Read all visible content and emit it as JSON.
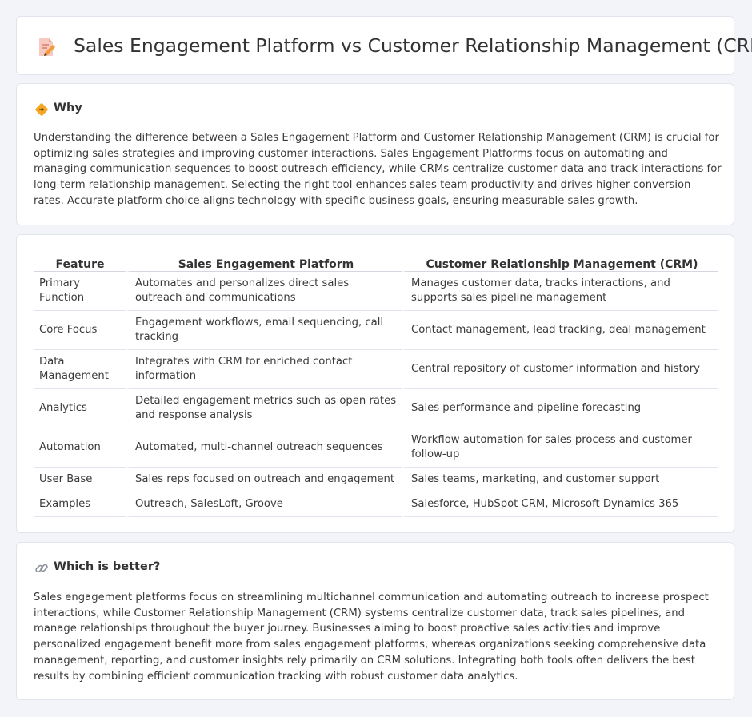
{
  "header": {
    "title": "Sales Engagement Platform vs Customer Relationship Management (CRM)",
    "icon": "pencil-document-icon"
  },
  "why": {
    "heading": "Why",
    "icon": "diamond-signpost-icon",
    "text": "Understanding the difference between a Sales Engagement Platform and Customer Relationship Management (CRM) is crucial for optimizing sales strategies and improving customer interactions. Sales Engagement Platforms focus on automating and managing communication sequences to boost outreach efficiency, while CRMs centralize customer data and track interactions for long-term relationship management. Selecting the right tool enhances sales team productivity and drives higher conversion rates. Accurate platform choice aligns technology with specific business goals, ensuring measurable sales growth."
  },
  "table": {
    "headers": [
      "Feature",
      "Sales Engagement Platform",
      "Customer Relationship Management (CRM)"
    ],
    "rows": [
      [
        "Primary Function",
        "Automates and personalizes direct sales outreach and communications",
        "Manages customer data, tracks interactions, and supports sales pipeline management"
      ],
      [
        "Core Focus",
        "Engagement workflows, email sequencing, call tracking",
        "Contact management, lead tracking, deal management"
      ],
      [
        "Data Management",
        "Integrates with CRM for enriched contact information",
        "Central repository of customer information and history"
      ],
      [
        "Analytics",
        "Detailed engagement metrics such as open rates and response analysis",
        "Sales performance and pipeline forecasting"
      ],
      [
        "Automation",
        "Automated, multi-channel outreach sequences",
        "Workflow automation for sales process and customer follow-up"
      ],
      [
        "User Base",
        "Sales reps focused on outreach and engagement",
        "Sales teams, marketing, and customer support"
      ],
      [
        "Examples",
        "Outreach, SalesLoft, Groove",
        "Salesforce, HubSpot CRM, Microsoft Dynamics 365"
      ]
    ]
  },
  "better": {
    "heading": "Which is better?",
    "icon": "link-icon",
    "text": "Sales engagement platforms focus on streamlining multichannel communication and automating outreach to increase prospect interactions, while Customer Relationship Management (CRM) systems centralize customer data, track sales pipelines, and manage relationships throughout the buyer journey. Businesses aiming to boost proactive sales activities and improve personalized engagement benefit more from sales engagement platforms, whereas organizations seeking comprehensive data management, reporting, and customer insights rely primarily on CRM solutions. Integrating both tools often delivers the best results by combining efficient communication tracking with robust customer data analytics."
  }
}
